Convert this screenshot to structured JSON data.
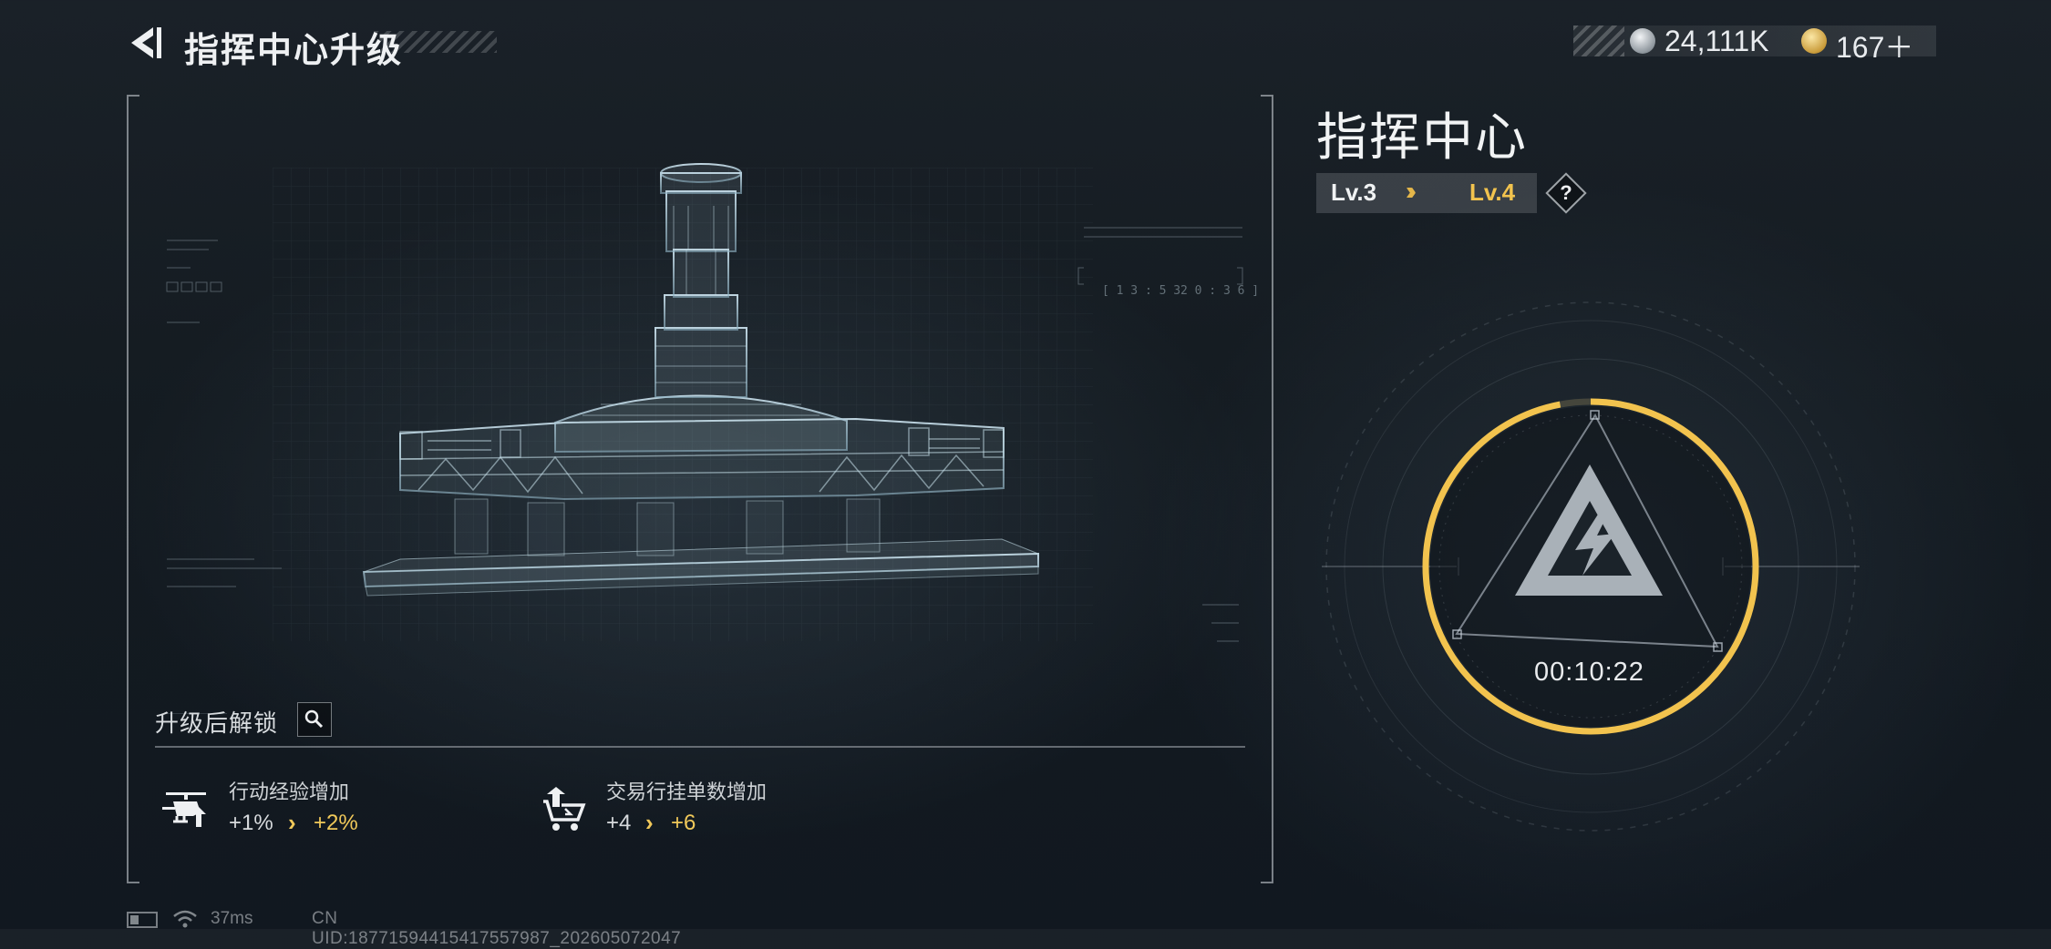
{
  "header": {
    "title": "指挥中心升级",
    "currencies": [
      {
        "icon": "silver-coin-icon",
        "value": "24,111K"
      },
      {
        "icon": "gold-coin-icon",
        "value": "167＋"
      }
    ]
  },
  "building": {
    "name": "指挥中心",
    "level_current": "Lv.3",
    "level_next": "Lv.4",
    "help_label": "?",
    "upgrade_timer": "00:10:22",
    "upgrade_progress": 0.97
  },
  "unlock": {
    "label": "升级后解锁",
    "bonuses": [
      {
        "icon": "helicopter-upgrade-icon",
        "title": "行动经验增加",
        "from": "+1%",
        "to": "+2%"
      },
      {
        "icon": "trade-cart-upgrade-icon",
        "title": "交易行挂单数增加",
        "from": "+4",
        "to": "+6"
      }
    ]
  },
  "status": {
    "ping": "37ms",
    "uid": "CN UID:18771594415417557987_202605072047"
  },
  "colors": {
    "accent_gold": "#f2c34e",
    "text_primary": "#e6e8ea",
    "background": "#151c22"
  }
}
